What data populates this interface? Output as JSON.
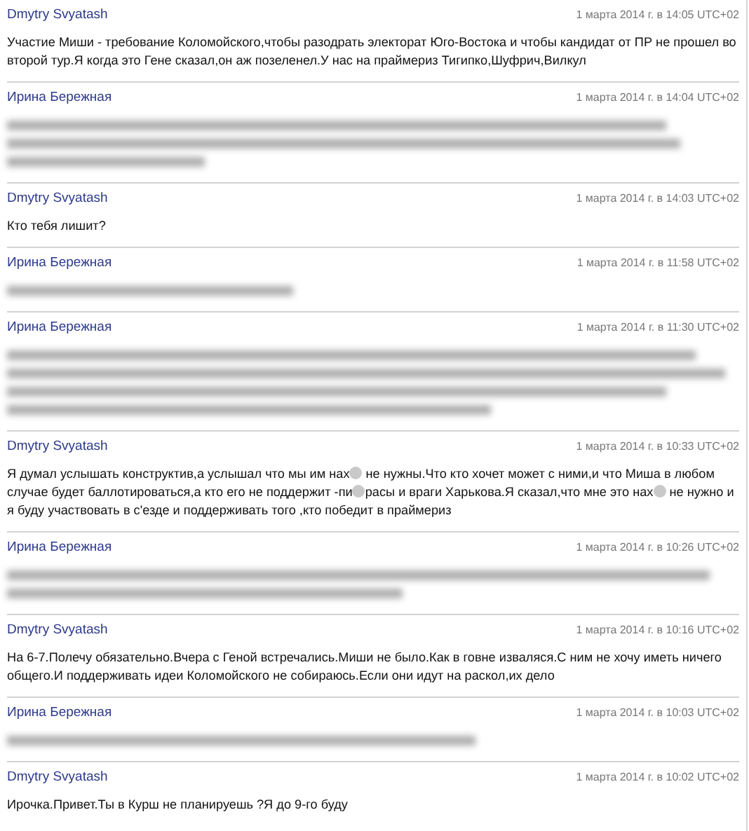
{
  "messages": [
    {
      "author": "Dmytry Svyatash",
      "time": "1 марта 2014 г. в 14:05 UTC+02",
      "kind": "text",
      "body": [
        {
          "kind": "text",
          "text": "Участие Миши - требование Коломойского,чтобы разодрать электорат Юго-Востока и чтобы кандидат от ПР не прошел во второй тур.Я когда это Гене сказал,он аж позеленел.У нас на праймериз Тигипко,Шуфрич,Вилкул"
        }
      ]
    },
    {
      "author": "Ирина Бережная",
      "time": "1 марта 2014 г. в 14:04 UTC+02",
      "kind": "blurred",
      "lines": [
        {
          "level": 0.9
        },
        {
          "level": 0.92
        },
        {
          "level": 0.27
        }
      ]
    },
    {
      "author": "Dmytry Svyatash",
      "time": "1 марта 2014 г. в 14:03 UTC+02",
      "kind": "text",
      "body": [
        {
          "kind": "text",
          "text": "Кто тебя лишит?"
        }
      ]
    },
    {
      "author": "Ирина Бережная",
      "time": "1 марта 2014 г. в 11:58 UTC+02",
      "kind": "blurred",
      "lines": [
        {
          "level": 0.39
        }
      ]
    },
    {
      "author": "Ирина Бережная",
      "time": "1 марта 2014 г. в 11:30 UTC+02",
      "kind": "blurred",
      "lines": [
        {
          "level": 0.94
        },
        {
          "level": 0.98
        },
        {
          "level": 0.9
        },
        {
          "level": 0.66
        }
      ]
    },
    {
      "author": "Dmytry Svyatash",
      "time": "1 марта 2014 г. в 10:33 UTC+02",
      "kind": "text",
      "body": [
        {
          "kind": "text",
          "text": "Я думал услышать конструктив,а услышал что мы им нах"
        },
        {
          "kind": "censored"
        },
        {
          "kind": "text",
          "text": " не нужны.Что кто хочет может с ними,и что Миша в любом случае будет баллотироваться,а кто его не поддержит -пи"
        },
        {
          "kind": "censored"
        },
        {
          "kind": "text",
          "text": "расы и враги Харькова.Я сказал,что мне это нах"
        },
        {
          "kind": "censored"
        },
        {
          "kind": "text",
          "text": " не нужно и я буду участвовать в с'езде и поддерживать того ,кто победит в праймериз"
        }
      ]
    },
    {
      "author": "Ирина Бережная",
      "time": "1 марта 2014 г. в 10:26 UTC+02",
      "kind": "blurred",
      "lines": [
        {
          "level": 0.96
        },
        {
          "level": 0.54
        }
      ]
    },
    {
      "author": "Dmytry Svyatash",
      "time": "1 марта 2014 г. в 10:16 UTC+02",
      "kind": "text",
      "body": [
        {
          "kind": "text",
          "text": "На 6-7.Полечу обязательно.Вчера с Геной встречались.Миши не было.Как в говне изваляся.С ним не хочу иметь ничего общего.И поддерживать идеи Коломойского не собираюсь.Если они идут на раскол,их дело"
        }
      ]
    },
    {
      "author": "Ирина Бережная",
      "time": "1 марта 2014 г. в 10:03 UTC+02",
      "kind": "blurred",
      "lines": [
        {
          "level": 0.64
        }
      ]
    },
    {
      "author": "Dmytry Svyatash",
      "time": "1 марта 2014 г. в 10:02 UTC+02",
      "kind": "text",
      "body": [
        {
          "kind": "text",
          "text": "Ирочка.Привет.Ты в Курш не планируешь ?Я до 9-го буду"
        }
      ]
    }
  ]
}
